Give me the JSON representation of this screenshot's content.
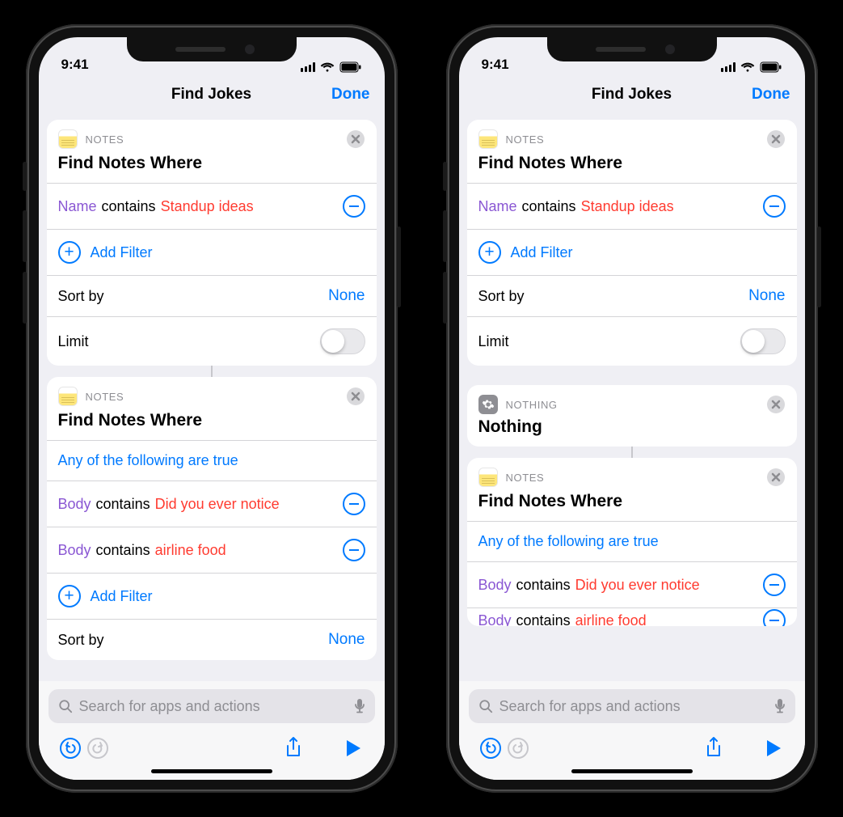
{
  "status": {
    "time": "9:41"
  },
  "phones": [
    {
      "nav": {
        "title": "Find Jokes",
        "done": "Done"
      },
      "search": {
        "placeholder": "Search for apps and actions"
      },
      "cards": [
        {
          "app_label": "NOTES",
          "title": "Find Notes Where",
          "filters": [
            {
              "field": "Name",
              "op": "contains",
              "val": "Standup ideas"
            }
          ],
          "add_filter": "Add Filter",
          "sort": {
            "label": "Sort by",
            "value": "None"
          },
          "limit": {
            "label": "Limit",
            "on": false
          }
        },
        {
          "app_label": "NOTES",
          "title": "Find Notes Where",
          "any": "Any of the following are true",
          "filters": [
            {
              "field": "Body",
              "op": "contains",
              "val": "Did you ever notice"
            },
            {
              "field": "Body",
              "op": "contains",
              "val": "airline food"
            }
          ],
          "add_filter": "Add Filter",
          "sort": {
            "label": "Sort by",
            "value": "None"
          }
        }
      ]
    },
    {
      "nav": {
        "title": "Find Jokes",
        "done": "Done"
      },
      "search": {
        "placeholder": "Search for apps and actions"
      },
      "cards": [
        {
          "app_label": "NOTES",
          "title": "Find Notes Where",
          "filters": [
            {
              "field": "Name",
              "op": "contains",
              "val": "Standup ideas"
            }
          ],
          "add_filter": "Add Filter",
          "sort": {
            "label": "Sort by",
            "value": "None"
          },
          "limit": {
            "label": "Limit",
            "on": false
          }
        },
        {
          "app_label": "NOTHING",
          "title": "Nothing",
          "kind": "nothing"
        },
        {
          "app_label": "NOTES",
          "title": "Find Notes Where",
          "any": "Any of the following are true",
          "filters": [
            {
              "field": "Body",
              "op": "contains",
              "val": "Did you ever notice"
            },
            {
              "field": "Body",
              "op": "contains",
              "val": "airline food"
            }
          ]
        }
      ]
    }
  ]
}
